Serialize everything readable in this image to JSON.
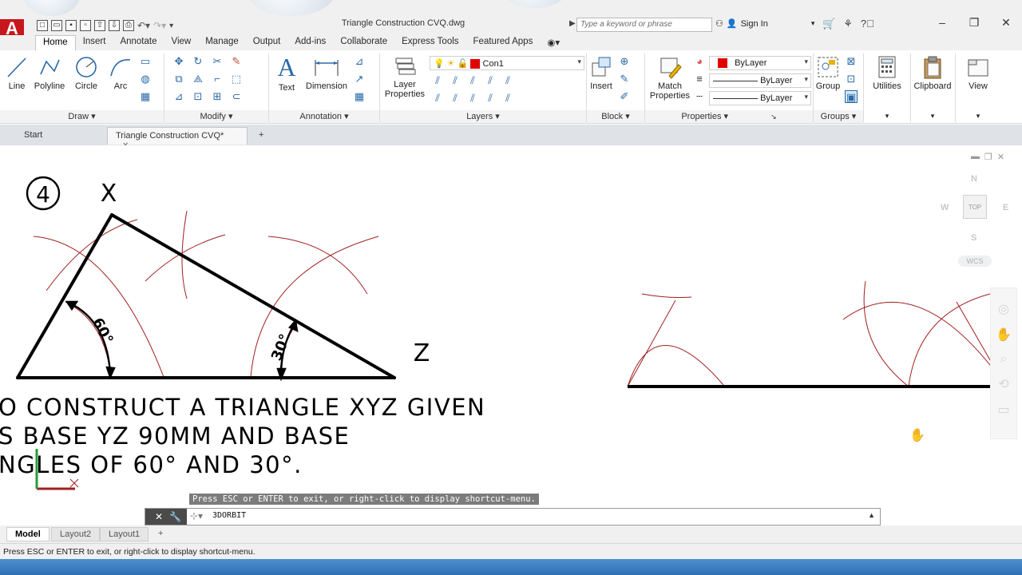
{
  "window": {
    "title": "Triangle Construction CVQ.dwg",
    "logo_letter": "A",
    "search_placeholder": "Type a keyword or phrase",
    "sign_in": "Sign In",
    "controls": [
      "–",
      "❐",
      "✕"
    ]
  },
  "ribbon": {
    "tabs": [
      "Home",
      "Insert",
      "Annotate",
      "View",
      "Manage",
      "Output",
      "Add-ins",
      "Collaborate",
      "Express Tools",
      "Featured Apps"
    ],
    "active_tab": "Home",
    "draw_tools": [
      "Line",
      "Polyline",
      "Circle",
      "Arc"
    ],
    "annotation_tools": [
      "Text",
      "Dimension"
    ],
    "layer_properties": "Layer Properties",
    "layer_name": "Con1",
    "insert": "Insert",
    "match_properties": "Match Properties",
    "property_values": [
      "ByLayer",
      "ByLayer",
      "ByLayer"
    ],
    "group": "Group",
    "utilities": "Utilities",
    "clipboard": "Clipboard",
    "view": "View",
    "panels": [
      "Draw",
      "Modify",
      "Annotation",
      "Layers",
      "Block",
      "Properties",
      "Groups"
    ]
  },
  "file_tabs": {
    "start": "Start",
    "current": "Triangle Construction CVQ*",
    "close": "✕",
    "add": "+"
  },
  "drawing": {
    "number": "4",
    "vertex_x": "X",
    "vertex_z": "Z",
    "angle_60": "60°",
    "angle_30": "30°",
    "text_lines": [
      "O CONSTRUCT A TRIANGLE XYZ GIVEN",
      "S BASE YZ 90MM AND BASE",
      "NGLES OF 60° AND 30°."
    ],
    "colors": {
      "arc": "#a01f1f",
      "line": "#000000"
    }
  },
  "viewcube": {
    "north": "N",
    "south": "S",
    "east": "E",
    "west": "W",
    "face": "TOP",
    "wcs": "WCS"
  },
  "command": {
    "tooltip": "Press ESC or ENTER to exit, or right-click to display shortcut-menu.",
    "current": "3DORBIT"
  },
  "layout_tabs": [
    "Model",
    "Layout2",
    "Layout1"
  ],
  "layout_add": "+",
  "status": "Press ESC or ENTER to exit, or right-click to display shortcut-menu."
}
